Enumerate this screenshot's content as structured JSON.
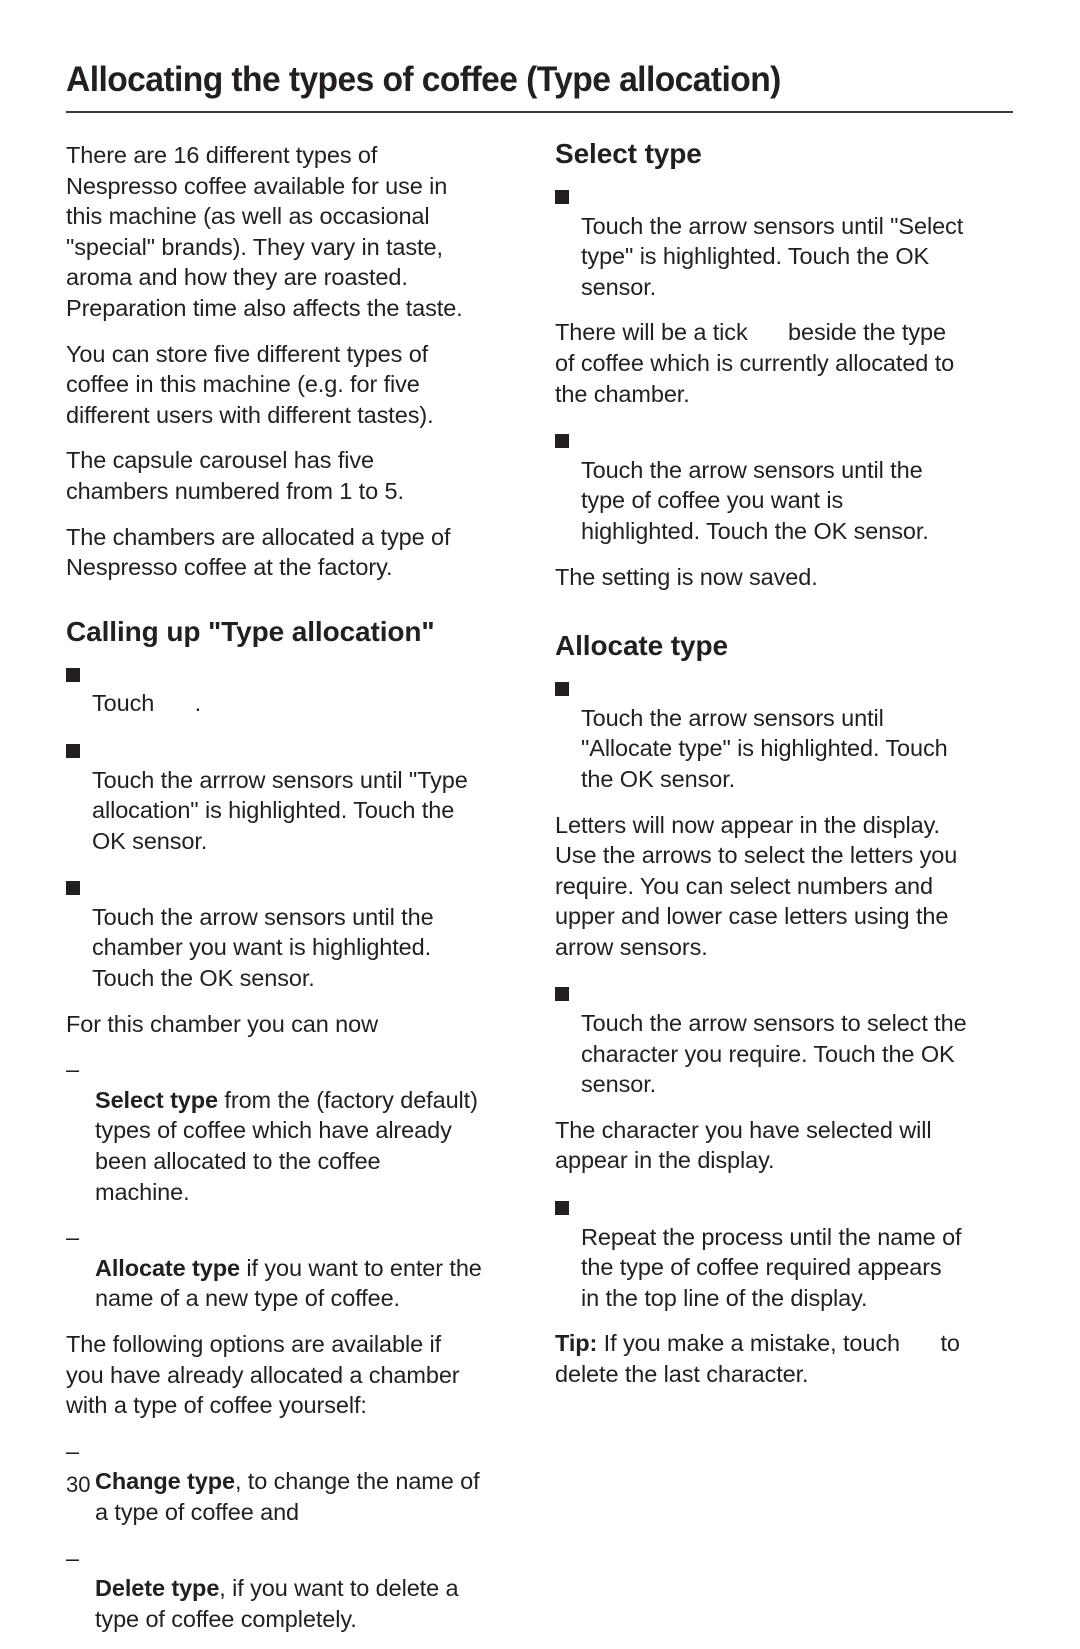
{
  "page": {
    "title": "Allocating the types of coffee (Type allocation)",
    "page_number": "30"
  },
  "left": {
    "intro": [
      "There are 16 different types of\nNespresso coffee available for use in\nthis machine (as well as occasional\n\"special\" brands).  They vary in taste,\naroma and how they are roasted.\nPreparation time also affects the taste.",
      "You can store five different types of\ncoffee in this machine (e.g. for five\ndifferent users with different tastes).",
      "The capsule carousel has five\nchambers numbered from 1 to 5.",
      "The chambers are allocated a type of\nNespresso coffee at the factory."
    ],
    "calling_up": {
      "heading": "Calling up \"Type allocation\"",
      "step1_pre": "Touch",
      "step1_post": ".",
      "step1_icon": "menu-sensor-icon",
      "step2": "Touch the arrrow sensors until \"Type\nallocation\" is highlighted. Touch the\nOK sensor.",
      "step3": "Touch the arrow sensors until the\nchamber you want is highlighted.\nTouch the OK sensor.",
      "for_chamber": "For this chamber you can now",
      "options": [
        {
          "bold": "Select type",
          "rest": " from the (factory default)\ntypes of coffee which have already\nbeen allocated to the coffee\nmachine."
        },
        {
          "bold": "Allocate type",
          "rest": " if you want to enter the\nname of a new type of coffee."
        }
      ],
      "following": "The following options are available if\nyou have already allocated a chamber\nwith a type of coffee yourself:",
      "options2": [
        {
          "bold": "Change type",
          "rest": ", to change the name of\na type of coffee and"
        },
        {
          "bold": "Delete type",
          "rest": ", if you want to delete a\ntype of coffee completely."
        }
      ],
      "dash": "–"
    }
  },
  "right": {
    "select_type": {
      "heading": "Select type",
      "step1": "Touch the arrow sensors until \"Select\ntype\" is highlighted. Touch the OK\nsensor.",
      "tick_pre": "There will be a tick",
      "tick_post": "beside the type\nof coffee which is currently allocated to\nthe chamber.",
      "tick_icon": "tick-icon",
      "step2": "Touch the arrow sensors until the\ntype of coffee you want is\nhighlighted.  Touch the OK sensor.",
      "saved": "The setting is now saved."
    },
    "allocate_type": {
      "heading": "Allocate type",
      "step1": "Touch the arrow sensors until\n\"Allocate type\" is highlighted. Touch\nthe OK sensor.",
      "letters": "Letters will now appear in the display.\nUse the arrows to select the letters you\nrequire. You can select numbers and\nupper and lower case letters using the\narrow sensors.",
      "step2": "Touch the arrow sensors to select the\ncharacter you require. Touch the OK\nsensor.",
      "char_selected": "The character you have selected will\nappear in the display.",
      "step3": "Repeat the process until the name of\nthe type of coffee required appears\nin the top line of the display.",
      "tip_label": "Tip:",
      "tip_pre": " If you make a mistake, touch",
      "tip_post": "to\ndelete the last character.",
      "tip_icon": "delete-character-icon"
    }
  }
}
